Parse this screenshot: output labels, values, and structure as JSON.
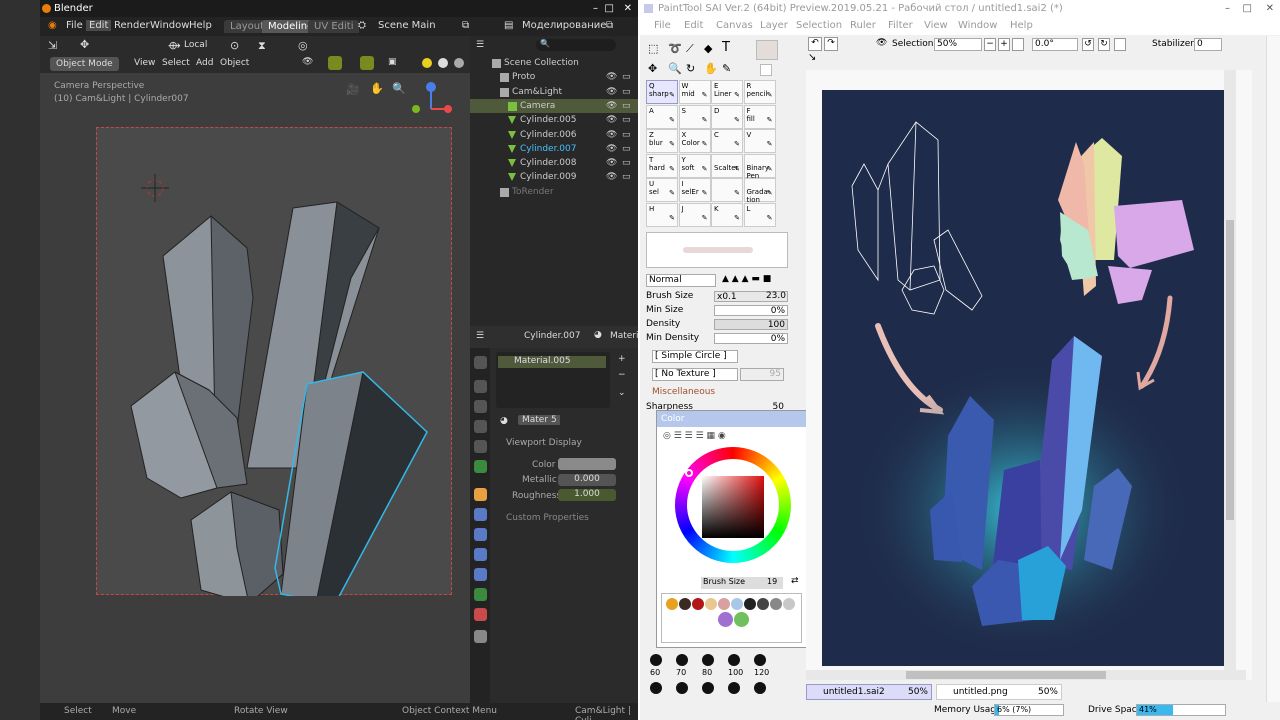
{
  "blender": {
    "title": "Blender",
    "menu": [
      "File",
      "Edit",
      "Render",
      "Window",
      "Help"
    ],
    "tabs": [
      "Layout",
      "Modeling",
      "UV Editi"
    ],
    "scene": "Scene Main",
    "viewlayer": "Моделирование",
    "orientation": "Local",
    "mode": "Object Mode",
    "view_menu": [
      "View",
      "Select",
      "Add",
      "Object"
    ],
    "camera_label": "Camera Perspective",
    "camera_sub": "(10) Cam&Light | Cylinder007",
    "outliner": [
      {
        "label": "Scene Collection"
      },
      {
        "label": "Proto"
      },
      {
        "label": "Cam&Light"
      },
      {
        "label": "Camera",
        "selected": true
      },
      {
        "label": "Cylinder.005"
      },
      {
        "label": "Cylinder.006"
      },
      {
        "label": "Cylinder.007",
        "active": true
      },
      {
        "label": "Cylinder.008"
      },
      {
        "label": "Cylinder.009"
      },
      {
        "label": "ToRender",
        "dim": true
      }
    ],
    "props_object": "Cylinder.007",
    "props_tab": "Materia",
    "material_slot": "Material.005",
    "mater_field": "Mater",
    "mater_users": "5",
    "viewport_display": "Viewport Display",
    "color_label": "Color",
    "metallic_label": "Metallic",
    "metallic_value": "0.000",
    "roughness_label": "Roughness",
    "roughness_value": "1.000",
    "custom_props": "Custom Properties",
    "status": [
      "Select",
      "Move",
      "Rotate View",
      "Object Context Menu",
      "Cam&Light | Cyli"
    ]
  },
  "sai": {
    "title": "PaintTool SAI Ver.2 (64bit) Preview.2019.05.21 - Рабочий стол / untitled1.sai2 (*)",
    "menu": [
      "File",
      "Edit",
      "Canvas",
      "Layer",
      "Selection",
      "Ruler",
      "Filter",
      "View",
      "Window",
      "Help"
    ],
    "selection_label": "Selection",
    "zoom": "50%",
    "angle": "0.0°",
    "stabilizer_label": "Stabilizer",
    "stabilizer_value": "0",
    "brushes": [
      [
        "Q",
        "sharp"
      ],
      [
        "W",
        "mid"
      ],
      [
        "E",
        "Liner"
      ],
      [
        "R",
        "pencil"
      ],
      [
        "A",
        ""
      ],
      [
        "S",
        ""
      ],
      [
        "D",
        ""
      ],
      [
        "F",
        "fill"
      ],
      [
        "Z",
        "blur"
      ],
      [
        "X",
        "Color"
      ],
      [
        "C",
        ""
      ],
      [
        "V",
        ""
      ],
      [
        "T",
        "hard"
      ],
      [
        "Y",
        "soft"
      ],
      [
        "",
        "Scalter"
      ],
      [
        "",
        "Binary Pen"
      ],
      [
        "U",
        "sel"
      ],
      [
        "I",
        "selEr"
      ],
      [
        "",
        ""
      ],
      [
        "",
        "Grada- tion"
      ],
      [
        "H",
        ""
      ],
      [
        "J",
        ""
      ],
      [
        "K",
        ""
      ],
      [
        "L",
        ""
      ]
    ],
    "blend_mode": "Normal",
    "brush_size_label": "Brush Size",
    "brush_size_mult": "x0.1",
    "brush_size_value": "23.0",
    "min_size_label": "Min Size",
    "min_size_value": "0%",
    "density_label": "Density",
    "density_value": "100",
    "min_density_label": "Min Density",
    "min_density_value": "0%",
    "shape": "[ Simple Circle ]",
    "texture": "[ No Texture ]",
    "texture_val": "95",
    "misc_label": "Miscellaneous",
    "sharpness_label": "Sharpness",
    "sharpness_value": "50",
    "color_panel_title": "Color",
    "cp_brush_size_label": "Brush Size",
    "cp_brush_size_value": "19",
    "swatches": [
      "#e8a020",
      "#3a2a22",
      "#b01818",
      "#e8c890",
      "#d8a0a0",
      "#a8c8e8",
      "#222222",
      "#444444",
      "#888888",
      "#c8c8c8",
      "#a070d0",
      "#70c060"
    ],
    "dot_sizes": [
      "60",
      "70",
      "80",
      "100",
      "120"
    ],
    "files": [
      {
        "name": "untitled1.sai2",
        "zoom": "50%"
      },
      {
        "name": "untitled.png",
        "zoom": "50%"
      }
    ],
    "memory_label": "Memory Usage",
    "memory_value": "6% (7%)",
    "memory_level": 0.06,
    "drive_label": "Drive Space",
    "drive_value": "41%",
    "drive_level": 0.41
  }
}
